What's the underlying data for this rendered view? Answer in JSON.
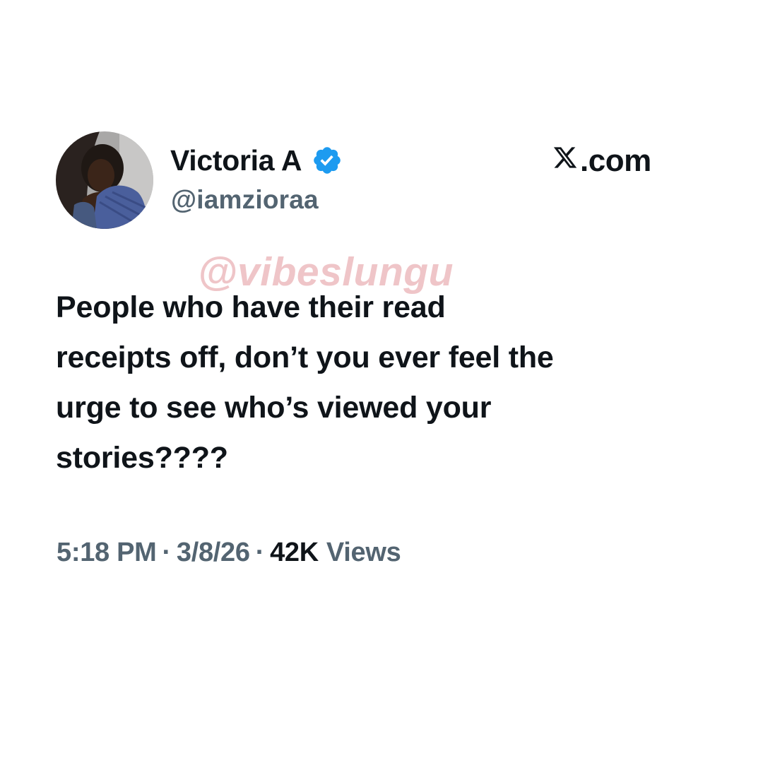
{
  "tweet": {
    "author": {
      "display_name": "Victoria A",
      "handle": "@iamzioraa",
      "verified": true,
      "verified_icon": "verified-badge-icon",
      "verified_color": "#1d9bf0"
    },
    "text_lines": [
      "People who have their read",
      "receipts off, don’t you ever feel the",
      "urge to see who’s viewed your",
      "stories????"
    ],
    "time": "5:18 PM",
    "date": "3/8/26",
    "separator": "·",
    "views_count": "42K",
    "views_label": "Views"
  },
  "site": {
    "logo_icon": "x-logo-icon",
    "domain": ".com"
  },
  "watermark": "@vibeslungu",
  "colors": {
    "text_primary": "#0f1419",
    "text_secondary": "#536471",
    "watermark": "#efc5c8",
    "background": "#ffffff"
  }
}
